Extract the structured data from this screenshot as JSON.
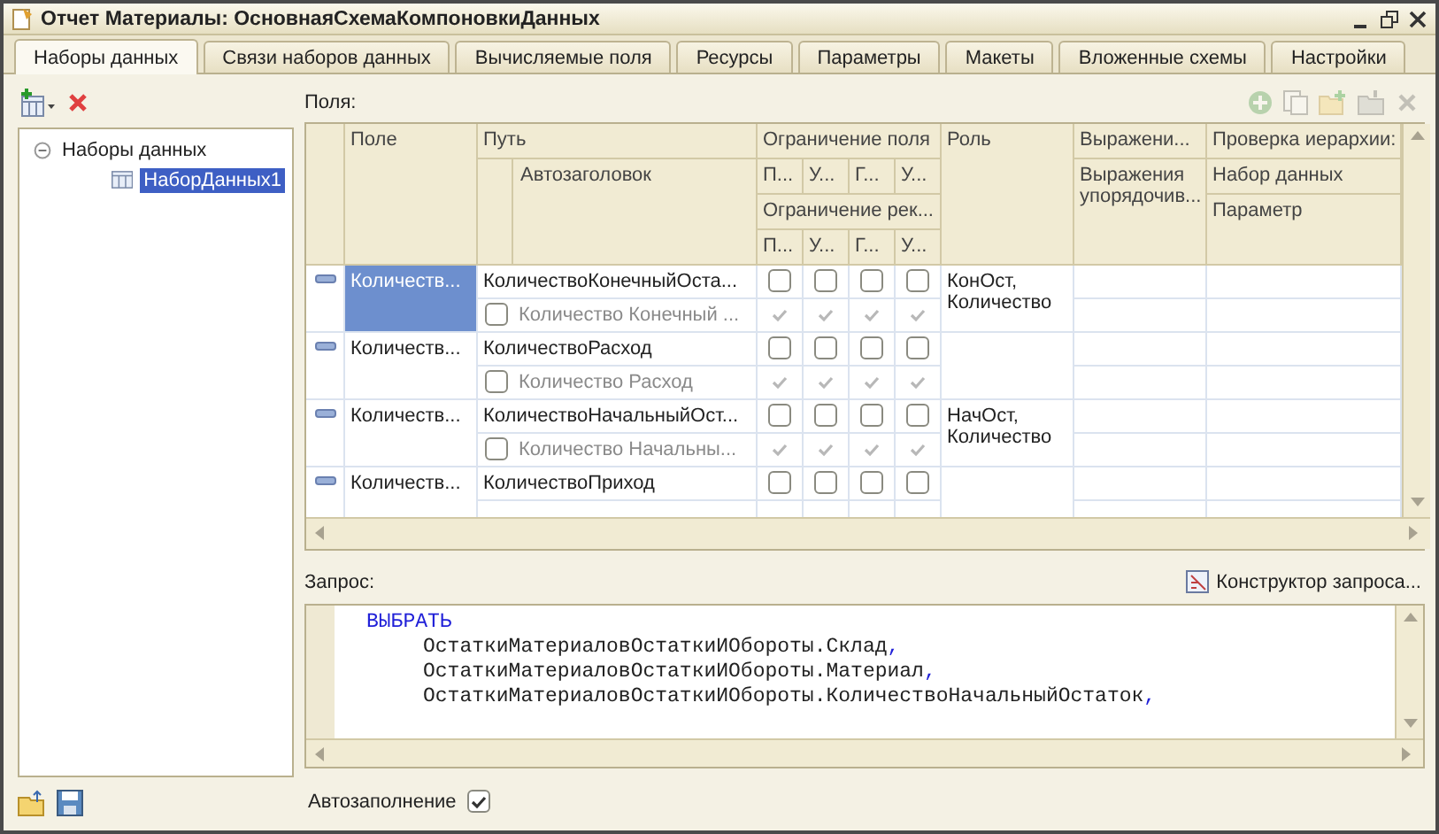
{
  "window": {
    "title": "Отчет Материалы: ОсновнаяСхемаКомпоновкиДанных"
  },
  "tabs": [
    {
      "label": "Наборы данных",
      "selected": true
    },
    {
      "label": "Связи наборов данных",
      "selected": false
    },
    {
      "label": "Вычисляемые поля",
      "selected": false
    },
    {
      "label": "Ресурсы",
      "selected": false
    },
    {
      "label": "Параметры",
      "selected": false
    },
    {
      "label": "Макеты",
      "selected": false
    },
    {
      "label": "Вложенные схемы",
      "selected": false
    },
    {
      "label": "Настройки",
      "selected": false
    }
  ],
  "tree": [
    {
      "label": "Наборы данных",
      "expanded": true,
      "selected": false,
      "children": [
        {
          "label": "НаборДанных1",
          "selected": true
        }
      ]
    }
  ],
  "fields_label": "Поля:",
  "fields_toolbar_disabled": true,
  "table": {
    "headers": {
      "field": "Поле",
      "path": "Путь",
      "title": "Автозаголовок",
      "field_restriction": "Ограничение поля",
      "field_restriction_flags": [
        "П...",
        "У...",
        "Г...",
        "У..."
      ],
      "requisite_restriction": "Ограничение рек...",
      "requisite_restriction_flags": [
        "П...",
        "У...",
        "Г...",
        "У..."
      ],
      "role": "Роль",
      "expression": "Выражени...",
      "order_expression": "Выражения упорядочив...",
      "hierarchy": "Проверка иерархии:",
      "dataset": "Набор данных",
      "parameter": "Параметр"
    },
    "rows": [
      {
        "field": "Количеств...",
        "selected": true,
        "path": "КоличествоКонечныйОста...",
        "title": "Количество Конечный ...",
        "title_checked": false,
        "field_restriction": [
          false,
          false,
          false,
          false
        ],
        "requisite_restriction": [
          true,
          true,
          true,
          true
        ],
        "role": "КонОст,\nКоличество"
      },
      {
        "field": "Количеств...",
        "selected": false,
        "path": "КоличествоРасход",
        "title": "Количество Расход",
        "title_checked": false,
        "field_restriction": [
          false,
          false,
          false,
          false
        ],
        "requisite_restriction": [
          true,
          true,
          true,
          true
        ]
      },
      {
        "field": "Количеств...",
        "selected": false,
        "path": "КоличествоНачальныйОст...",
        "title": "Количество Начальны...",
        "title_checked": false,
        "field_restriction": [
          false,
          false,
          false,
          false
        ],
        "requisite_restriction": [
          true,
          true,
          true,
          true
        ],
        "role": "НачОст,\nКоличество"
      },
      {
        "field": "Количеств...",
        "selected": false,
        "path": "КоличествоПриход",
        "field_restriction": [
          false,
          false,
          false,
          false
        ]
      }
    ]
  },
  "query": {
    "label": "Запрос:",
    "constructor_button": "Конструктор запроса...",
    "lines": [
      {
        "kind": "keyword",
        "text": "ВЫБРАТЬ"
      },
      {
        "kind": "field",
        "text": "ОстаткиМатериаловОстаткиИОбороты.Склад",
        "separator": ","
      },
      {
        "kind": "field",
        "text": "ОстаткиМатериаловОстаткиИОбороты.Материал",
        "separator": ","
      },
      {
        "kind": "field",
        "text": "ОстаткиМатериаловОстаткиИОбороты.КоличествоНачальныйОстаток",
        "separator": ","
      }
    ]
  },
  "autofill": {
    "label": "Автозаполнение",
    "checked": true
  }
}
